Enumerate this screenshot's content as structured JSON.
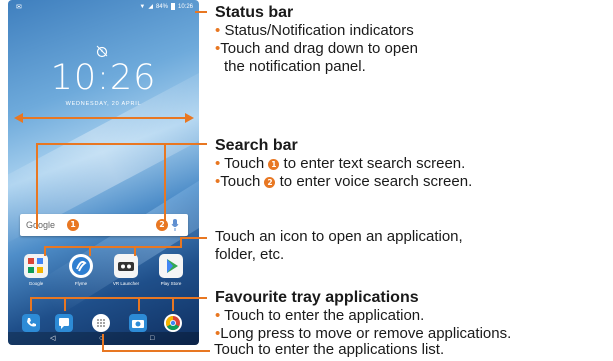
{
  "phone": {
    "status_time": "10:26",
    "status_battery": "84%",
    "clock": "10:26",
    "date": "WEDNESDAY, 20 APRIL",
    "search_label": "Google",
    "badge_1": "1",
    "badge_2": "2",
    "apps": [
      {
        "label": "Google",
        "icon": "google-folder-icon",
        "color": "#ffffff"
      },
      {
        "label": "Flyme",
        "icon": "flyme-icon",
        "color": "#2f7fd1"
      },
      {
        "label": "VR Launcher",
        "icon": "vr-icon",
        "color": "#ffffff"
      },
      {
        "label": "Play Store",
        "icon": "play-store-icon",
        "color": "#ffffff"
      }
    ],
    "dock": [
      {
        "icon": "phone-icon",
        "color": "#2d8bd6"
      },
      {
        "icon": "messages-icon",
        "color": "#2d8bd6"
      },
      {
        "icon": "apps-grid-icon",
        "color": "#ffffff"
      },
      {
        "icon": "camera-icon",
        "color": "#2d8bd6"
      },
      {
        "icon": "chrome-icon",
        "color": "#ffffff"
      }
    ],
    "nav": {
      "back": "◁",
      "home": "○",
      "recents": "□"
    }
  },
  "callouts": {
    "status_bar": {
      "title": "Status bar",
      "bullets": [
        "Status/Notification indicators",
        "Touch and drag down to open",
        "the notification panel."
      ]
    },
    "search_bar": {
      "title": "Search bar",
      "touch": "Touch",
      "bullet1_rest": "to enter text search screen.",
      "bullet2_rest": "to enter voice search screen.",
      "num1": "1",
      "num2": "2"
    },
    "icon": {
      "line1": "Touch an icon to open an application,",
      "line2": "folder, etc."
    },
    "favourite": {
      "title": "Favourite tray applications",
      "bullets": [
        "Touch to enter the application.",
        "Long press to move or remove applications."
      ]
    },
    "apps_list": "Touch to enter the applications list."
  },
  "colors": {
    "accent": "#e87722"
  }
}
